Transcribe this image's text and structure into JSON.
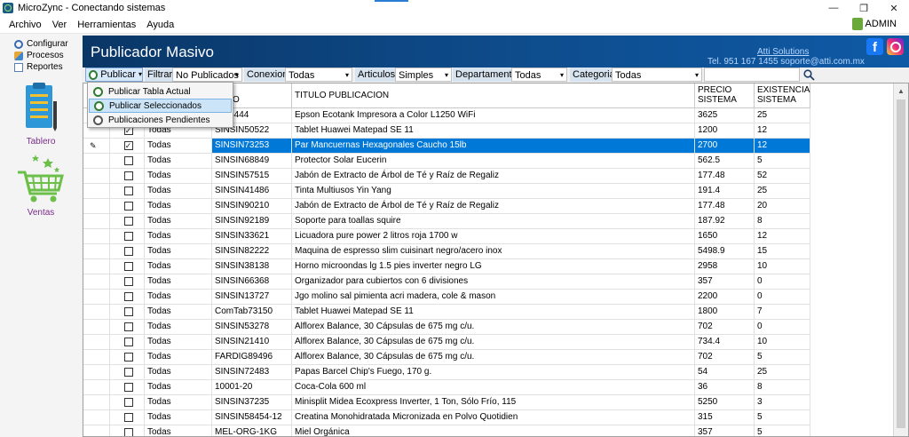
{
  "window": {
    "title": "MicroZync - Conectando sistemas",
    "minimize": "—",
    "restore": "❐",
    "close": "✕"
  },
  "menu": [
    "Archivo",
    "Ver",
    "Herramientas",
    "Ayuda"
  ],
  "user": "ADMIN",
  "nav": {
    "items": [
      "Configurar",
      "Procesos",
      "Reportes"
    ],
    "modules": [
      "Tablero",
      "Ventas"
    ]
  },
  "header": {
    "title": "Publicador Masivo",
    "company": "Atti Solutions",
    "contact": "Tel. 951 167 1455  soporte@atti.com.mx"
  },
  "filters": {
    "publicar": "Publicar",
    "filtrar_label": "Filtrar:",
    "filtrar_value": "No Publicados",
    "conexion_label": "Conexion:",
    "conexion_value": "Todas",
    "articulos_label": "Articulos:",
    "articulos_value": "Simples",
    "departamento_label": "Departamento:",
    "departamento_value": "Todas",
    "categoria_label": "Categoria:",
    "categoria_value": "Todas",
    "search_value": ""
  },
  "dropdown": {
    "items": [
      "Publicar Tabla Actual",
      "Publicar Seleccionados",
      "Publicaciones Pendientes"
    ],
    "hovered_index": 1
  },
  "grid": {
    "columns": {
      "articulo_line1": "E",
      "articulo_line2": "CULO",
      "titulo": "TITULO PUBLICACION",
      "precio_line1": "PRECIO",
      "precio_line2": "SISTEMA",
      "existencia_line1": "EXISTENCIA",
      "existencia_line2": "SISTEMA"
    },
    "selected_row": 2,
    "rows": [
      {
        "checked": false,
        "conexion": "",
        "articulo": "ec16444",
        "titulo": "Epson Ecotank Impresora a Color L1250 WiFi",
        "precio": "3625",
        "existencia": "25"
      },
      {
        "checked": true,
        "conexion": "Todas",
        "articulo": "SINSIN50522",
        "titulo": "Tablet Huawei Matepad SE 11",
        "precio": "1200",
        "existencia": "12"
      },
      {
        "checked": true,
        "conexion": "Todas",
        "articulo": "SINSIN73253",
        "titulo": "Par Mancuernas Hexagonales Caucho 15lb",
        "precio": "2700",
        "existencia": "12"
      },
      {
        "checked": false,
        "conexion": "Todas",
        "articulo": "SINSIN68849",
        "titulo": "Protector Solar Eucerin",
        "precio": "562.5",
        "existencia": "5"
      },
      {
        "checked": false,
        "conexion": "Todas",
        "articulo": "SINSIN57515",
        "titulo": "Jabón de Extracto de Árbol de Té y Raíz de Regaliz",
        "precio": "177.48",
        "existencia": "52"
      },
      {
        "checked": false,
        "conexion": "Todas",
        "articulo": "SINSIN41486",
        "titulo": "Tinta Multiusos Yin Yang",
        "precio": "191.4",
        "existencia": "25"
      },
      {
        "checked": false,
        "conexion": "Todas",
        "articulo": "SINSIN90210",
        "titulo": "Jabón de Extracto de Árbol de Té y Raíz de Regaliz",
        "precio": "177.48",
        "existencia": "20"
      },
      {
        "checked": false,
        "conexion": "Todas",
        "articulo": "SINSIN92189",
        "titulo": "Soporte para toallas squire",
        "precio": "187.92",
        "existencia": "8"
      },
      {
        "checked": false,
        "conexion": "Todas",
        "articulo": "SINSIN33621",
        "titulo": "Licuadora pure power 2 litros roja 1700 w",
        "precio": "1650",
        "existencia": "12"
      },
      {
        "checked": false,
        "conexion": "Todas",
        "articulo": "SINSIN82222",
        "titulo": "Maquina de espresso slim cuisinart negro/acero inox",
        "precio": "5498.9",
        "existencia": "15"
      },
      {
        "checked": false,
        "conexion": "Todas",
        "articulo": "SINSIN38138",
        "titulo": "Horno microondas lg 1.5 pies inverter negro LG",
        "precio": "2958",
        "existencia": "10"
      },
      {
        "checked": false,
        "conexion": "Todas",
        "articulo": "SINSIN66368",
        "titulo": "Organizador para cubiertos con 6 divisiones",
        "precio": "357",
        "existencia": "0"
      },
      {
        "checked": false,
        "conexion": "Todas",
        "articulo": "SINSIN13727",
        "titulo": "Jgo molino sal pimienta acri madera, cole & mason",
        "precio": "2200",
        "existencia": "0"
      },
      {
        "checked": false,
        "conexion": "Todas",
        "articulo": "ComTab73150",
        "titulo": "Tablet Huawei Matepad SE 11",
        "precio": "1800",
        "existencia": "7"
      },
      {
        "checked": false,
        "conexion": "Todas",
        "articulo": "SINSIN53278",
        "titulo": "Alflorex Balance, 30 Cápsulas de 675 mg c/u.",
        "precio": "702",
        "existencia": "0"
      },
      {
        "checked": false,
        "conexion": "Todas",
        "articulo": "SINSIN21410",
        "titulo": "Alflorex Balance, 30 Cápsulas de 675 mg c/u.",
        "precio": "734.4",
        "existencia": "10"
      },
      {
        "checked": false,
        "conexion": "Todas",
        "articulo": "FARDIG89496",
        "titulo": "Alflorex Balance, 30 Cápsulas de 675 mg c/u.",
        "precio": "702",
        "existencia": "5"
      },
      {
        "checked": false,
        "conexion": "Todas",
        "articulo": "SINSIN72483",
        "titulo": "Papas Barcel Chip's Fuego, 170 g.",
        "precio": "54",
        "existencia": "25"
      },
      {
        "checked": false,
        "conexion": "Todas",
        "articulo": "10001-20",
        "titulo": "Coca-Cola 600 ml",
        "precio": "36",
        "existencia": "8"
      },
      {
        "checked": false,
        "conexion": "Todas",
        "articulo": "SINSIN37235",
        "titulo": "Minisplit Midea Ecoxpress Inverter, 1 Ton, Sólo Frío, 115",
        "precio": "5250",
        "existencia": "3"
      },
      {
        "checked": false,
        "conexion": "Todas",
        "articulo": "SINSIN58454-12",
        "titulo": "Creatina Monohidratada Micronizada en Polvo Quotidien",
        "precio": "315",
        "existencia": "5"
      },
      {
        "checked": false,
        "conexion": "Todas",
        "articulo": "MEL-ORG-1KG",
        "titulo": "Miel Orgánica",
        "precio": "357",
        "existencia": "5"
      }
    ]
  }
}
